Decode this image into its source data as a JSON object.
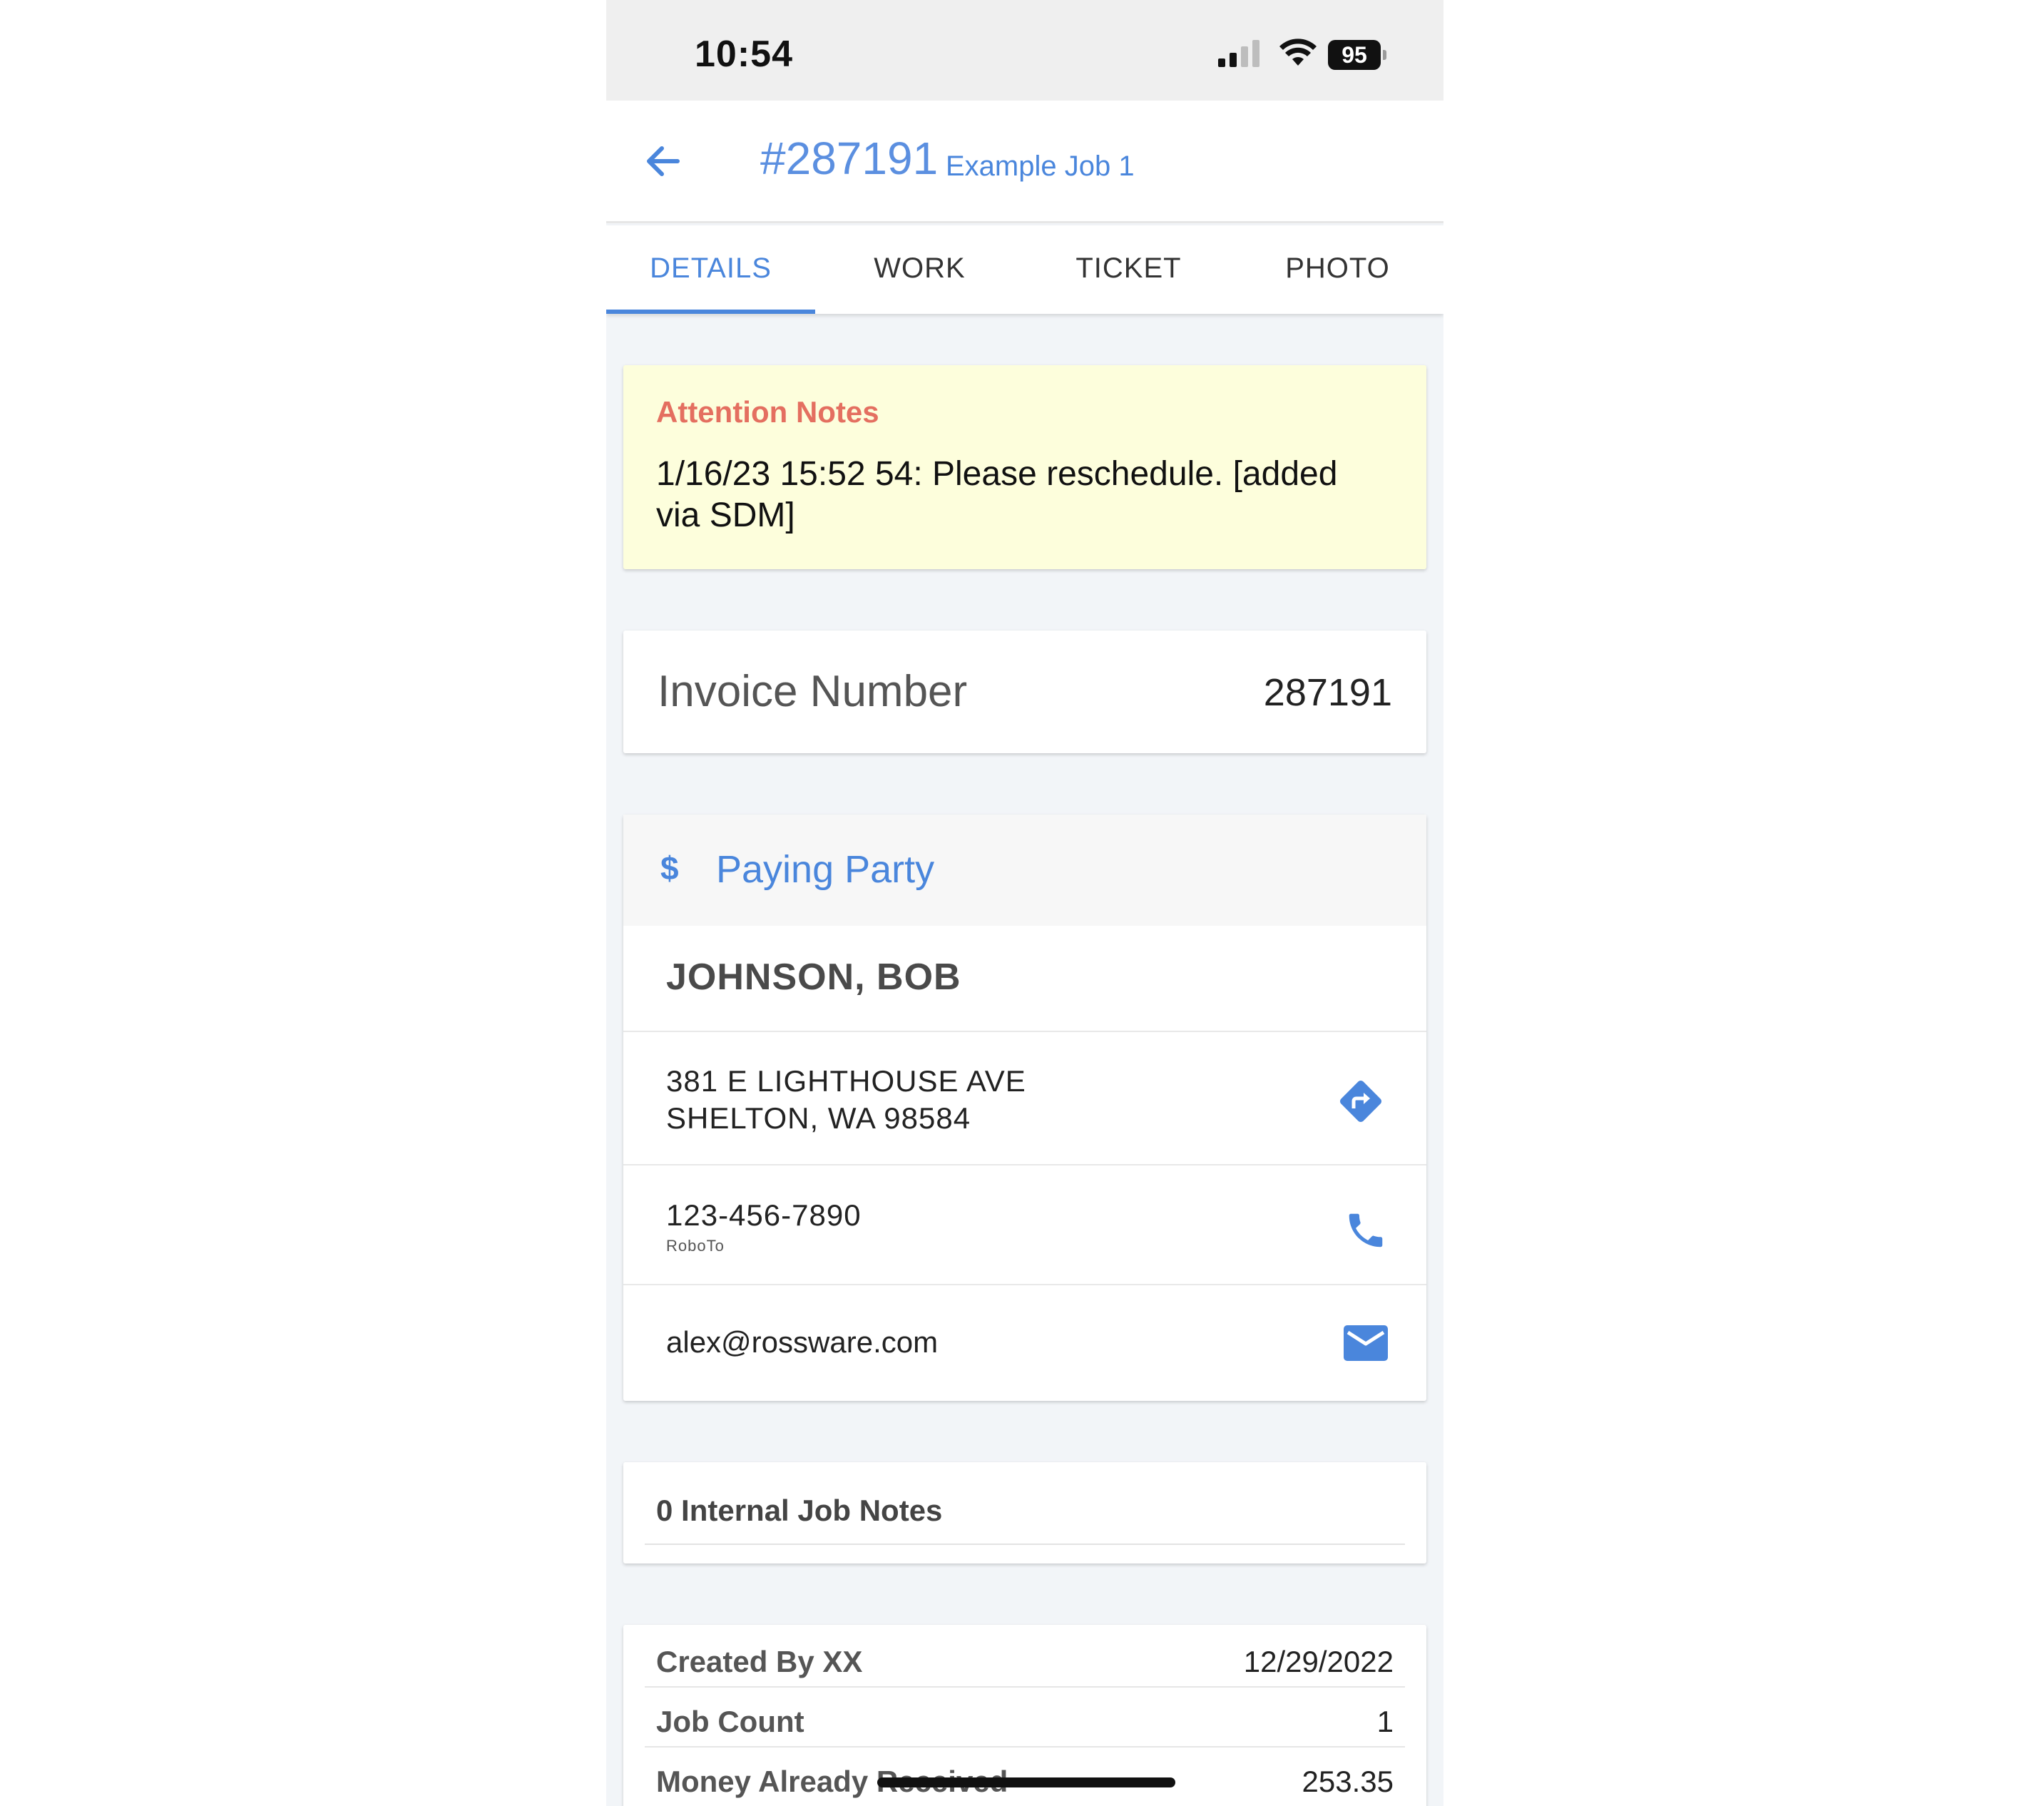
{
  "status_bar": {
    "time": "10:54",
    "battery": "95"
  },
  "header": {
    "job_number": "#287191",
    "job_name": "Example Job 1"
  },
  "tabs": [
    {
      "label": "DETAILS",
      "active": true
    },
    {
      "label": "WORK",
      "active": false
    },
    {
      "label": "TICKET",
      "active": false
    },
    {
      "label": "PHOTO",
      "active": false
    }
  ],
  "attention": {
    "title": "Attention Notes",
    "text": "1/16/23 15:52 54: Please reschedule. [added via SDM]"
  },
  "invoice": {
    "label": "Invoice Number",
    "value": "287191"
  },
  "paying_party": {
    "icon": "$",
    "title": "Paying Party",
    "name": "JOHNSON, BOB",
    "address_line1": "381 E LIGHTHOUSE AVE",
    "address_line2": "SHELTON, WA 98584",
    "phone": "123-456-7890",
    "phone_label": "RoboTo",
    "email": "alex@rossware.com"
  },
  "internal_notes": {
    "title": "0 Internal Job Notes"
  },
  "meta": [
    {
      "label": "Created By XX",
      "value": "12/29/2022"
    },
    {
      "label": "Job Count",
      "value": "1"
    },
    {
      "label": "Money Already Received",
      "value": "253.35"
    }
  ],
  "colors": {
    "accent": "#4a86dc",
    "attention_title": "#e46f60",
    "attention_bg": "#fdfedc"
  }
}
